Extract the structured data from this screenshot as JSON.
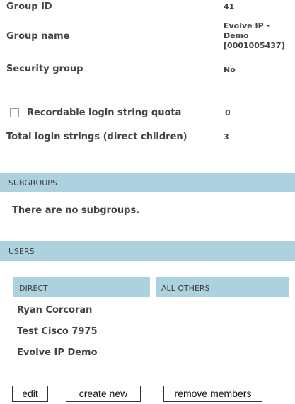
{
  "group_info": {
    "group_id_label": "Group ID",
    "group_id_value": "41",
    "group_name_label": "Group name",
    "group_name_line1": "Evolve IP -",
    "group_name_line2": "Demo",
    "group_name_line3": "[0001005437]",
    "security_group_label": "Security group",
    "security_group_value": "No",
    "recordable_label": "Recordable login string quota",
    "recordable_value": "0",
    "recordable_checked": false,
    "total_login_label": "Total login strings (direct children)",
    "total_login_value": "3"
  },
  "subgroups": {
    "header": "SUBGROUPS",
    "empty_text": "There are no subgroups."
  },
  "users": {
    "header": "USERS",
    "direct_header": "DIRECT",
    "all_others_header": "ALL OTHERS",
    "direct": [
      "Ryan Corcoran",
      "Test Cisco 7975",
      "Evolve IP Demo"
    ]
  },
  "buttons": {
    "edit": "edit",
    "create_new": "create new",
    "remove_members": "remove members"
  },
  "colors": {
    "section_bar": "#add2df",
    "text": "#444444"
  }
}
